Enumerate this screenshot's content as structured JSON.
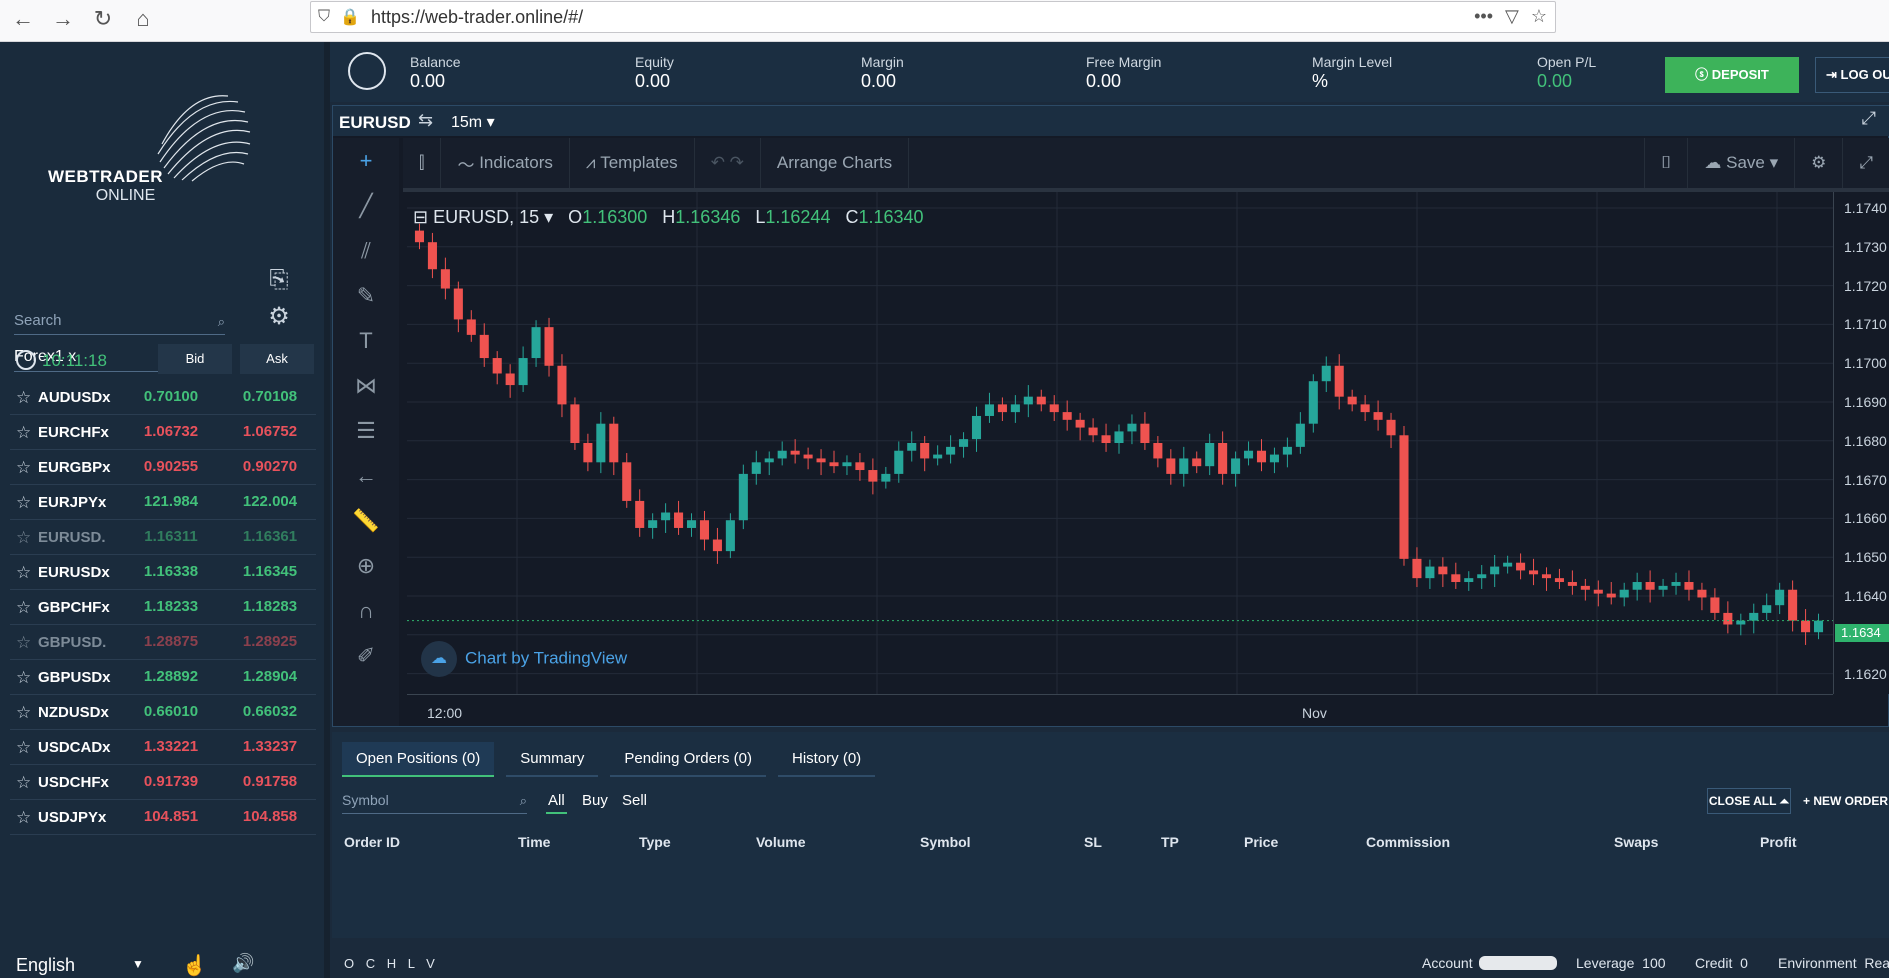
{
  "browser": {
    "url": "https://web-trader.online/#/"
  },
  "sidebar": {
    "brand_line1": "WEBTRADER",
    "brand_line2": "ONLINE",
    "search_placeholder": "Search",
    "group": "Forex1 x",
    "time": "10:11:18",
    "bid_label": "Bid",
    "ask_label": "Ask",
    "language": "English",
    "instruments": [
      {
        "symbol": "AUDUSDx",
        "bid": "0.70100",
        "ask": "0.70108",
        "bid_color": "g",
        "ask_color": "g",
        "dim": false
      },
      {
        "symbol": "EURCHFx",
        "bid": "1.06732",
        "ask": "1.06752",
        "bid_color": "r",
        "ask_color": "r",
        "dim": false
      },
      {
        "symbol": "EURGBPx",
        "bid": "0.90255",
        "ask": "0.90270",
        "bid_color": "r",
        "ask_color": "r",
        "dim": false
      },
      {
        "symbol": "EURJPYx",
        "bid": "121.984",
        "ask": "122.004",
        "bid_color": "g",
        "ask_color": "g",
        "dim": false
      },
      {
        "symbol": "EURUSD.",
        "bid": "1.16311",
        "ask": "1.16361",
        "bid_color": "g",
        "ask_color": "g",
        "dim": true
      },
      {
        "symbol": "EURUSDx",
        "bid": "1.16338",
        "ask": "1.16345",
        "bid_color": "g",
        "ask_color": "g",
        "dim": false
      },
      {
        "symbol": "GBPCHFx",
        "bid": "1.18233",
        "ask": "1.18283",
        "bid_color": "g",
        "ask_color": "g",
        "dim": false
      },
      {
        "symbol": "GBPUSD.",
        "bid": "1.28875",
        "ask": "1.28925",
        "bid_color": "r",
        "ask_color": "r",
        "dim": true
      },
      {
        "symbol": "GBPUSDx",
        "bid": "1.28892",
        "ask": "1.28904",
        "bid_color": "g",
        "ask_color": "g",
        "dim": false
      },
      {
        "symbol": "NZDUSDx",
        "bid": "0.66010",
        "ask": "0.66032",
        "bid_color": "g",
        "ask_color": "g",
        "dim": false
      },
      {
        "symbol": "USDCADx",
        "bid": "1.33221",
        "ask": "1.33237",
        "bid_color": "r",
        "ask_color": "r",
        "dim": false
      },
      {
        "symbol": "USDCHFx",
        "bid": "0.91739",
        "ask": "0.91758",
        "bid_color": "r",
        "ask_color": "r",
        "dim": false
      },
      {
        "symbol": "USDJPYx",
        "bid": "104.851",
        "ask": "104.858",
        "bid_color": "r",
        "ask_color": "r",
        "dim": false
      }
    ]
  },
  "account": {
    "balance_label": "Balance",
    "balance": "0.00",
    "equity_label": "Equity",
    "equity": "0.00",
    "margin_label": "Margin",
    "margin": "0.00",
    "free_margin_label": "Free Margin",
    "free_margin": "0.00",
    "margin_level_label": "Margin Level",
    "margin_level": "%",
    "open_pl_label": "Open P/L",
    "open_pl": "0.00",
    "deposit_label": "DEPOSIT",
    "logout_label": "LOG OU"
  },
  "chart": {
    "symbol": "EURUSD",
    "timeframe": "15m",
    "toolbar": {
      "indicators": "Indicators",
      "templates": "Templates",
      "arrange": "Arrange Charts",
      "save": "Save"
    },
    "legend_title": "EURUSD, 15",
    "open": "1.16300",
    "high": "1.16346",
    "low": "1.16244",
    "close": "1.16340",
    "attribution": "Chart by TradingView",
    "last_price_tag": "1.1634",
    "x_labels": [
      "12:00",
      "Nov"
    ],
    "y_ticks": [
      "1.1740",
      "1.1730",
      "1.1720",
      "1.1710",
      "1.1700",
      "1.1690",
      "1.1680",
      "1.1670",
      "1.1660",
      "1.1650",
      "1.1640",
      "1.1630",
      "1.1620"
    ],
    "colors": {
      "up": "#26a69a",
      "down": "#ef5350"
    }
  },
  "chart_data": {
    "type": "candlestick",
    "title": "EURUSD, 15",
    "ylim": [
      1.1615,
      1.1745
    ],
    "close_series": [
      1.1732,
      1.1725,
      1.172,
      1.1712,
      1.1708,
      1.1702,
      1.1698,
      1.1695,
      1.1702,
      1.171,
      1.17,
      1.169,
      1.168,
      1.1675,
      1.1685,
      1.1675,
      1.1665,
      1.1658,
      1.166,
      1.1662,
      1.1658,
      1.166,
      1.1655,
      1.1652,
      1.166,
      1.1672,
      1.1675,
      1.1676,
      1.1678,
      1.1677,
      1.1676,
      1.1675,
      1.1674,
      1.1675,
      1.1673,
      1.167,
      1.1672,
      1.1678,
      1.168,
      1.1676,
      1.1677,
      1.1679,
      1.1681,
      1.1687,
      1.169,
      1.1688,
      1.169,
      1.1692,
      1.169,
      1.1688,
      1.1686,
      1.1684,
      1.1682,
      1.168,
      1.1683,
      1.1685,
      1.168,
      1.1676,
      1.1672,
      1.1676,
      1.1674,
      1.168,
      1.1672,
      1.1676,
      1.1678,
      1.1675,
      1.1677,
      1.1679,
      1.1685,
      1.1696,
      1.17,
      1.1692,
      1.169,
      1.1688,
      1.1686,
      1.1682,
      1.165,
      1.1645,
      1.1648,
      1.1646,
      1.1644,
      1.1645,
      1.1646,
      1.1648,
      1.1649,
      1.1647,
      1.1646,
      1.1645,
      1.1644,
      1.1643,
      1.1642,
      1.1641,
      1.164,
      1.1642,
      1.1644,
      1.1642,
      1.1643,
      1.1644,
      1.1642,
      1.164,
      1.1636,
      1.1633,
      1.1634,
      1.1636,
      1.1638,
      1.1642,
      1.1634,
      1.1631,
      1.1634
    ]
  },
  "orders": {
    "tabs": [
      "Open Positions (0)",
      "Summary",
      "Pending Orders (0)",
      "History (0)"
    ],
    "symbol_placeholder": "Symbol",
    "filters": [
      "All",
      "Buy",
      "Sell"
    ],
    "close_all": "CLOSE ALL",
    "new_order": "NEW ORDER",
    "columns": [
      "Order ID",
      "Time",
      "Type",
      "Volume",
      "Symbol",
      "SL",
      "TP",
      "Price",
      "Commission",
      "Swaps",
      "Profit"
    ]
  },
  "status": {
    "ohlcv": "O C H L V",
    "account_label": "Account",
    "leverage_label": "Leverage",
    "leverage": "100",
    "credit_label": "Credit",
    "credit": "0",
    "environment_label": "Environment",
    "environment": "Rea"
  }
}
